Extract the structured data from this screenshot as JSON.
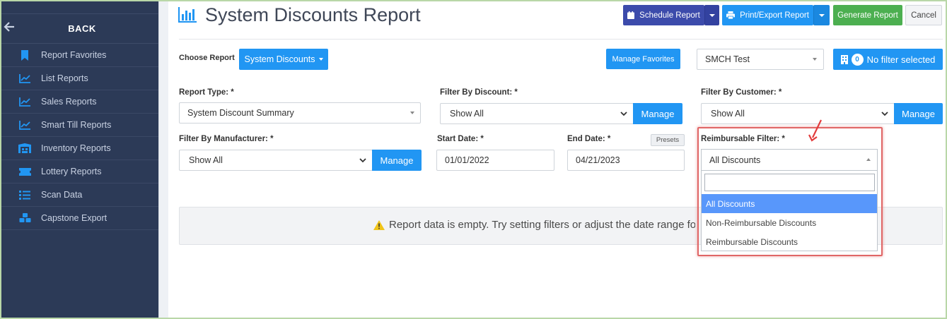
{
  "sidebar": {
    "back_label": "BACK",
    "items": [
      {
        "label": "Report Favorites",
        "icon": "bookmark-icon"
      },
      {
        "label": "List Reports",
        "icon": "line-chart-icon"
      },
      {
        "label": "Sales Reports",
        "icon": "line-chart-icon"
      },
      {
        "label": "Smart Till Reports",
        "icon": "line-chart-icon"
      },
      {
        "label": "Inventory Reports",
        "icon": "warehouse-icon"
      },
      {
        "label": "Lottery Reports",
        "icon": "ticket-icon"
      },
      {
        "label": "Scan Data",
        "icon": "list-icon"
      },
      {
        "label": "Capstone Export",
        "icon": "cubes-icon"
      }
    ]
  },
  "header": {
    "title": "System Discounts Report",
    "schedule_label": "Schedule Report",
    "print_label": "Print/Export Report",
    "generate_label": "Generate Report",
    "cancel_label": "Cancel"
  },
  "toolbar": {
    "choose_label": "Choose Report",
    "report_button": "System Discounts",
    "manage_favorites": "Manage Favorites",
    "store_value": "SMCH Test",
    "filter_count": "0",
    "filter_label": "No filter selected"
  },
  "filters": {
    "report_type": {
      "label": "Report Type: *",
      "value": "System Discount Summary"
    },
    "discount": {
      "label": "Filter By Discount: *",
      "value": "Show All",
      "manage": "Manage"
    },
    "customer": {
      "label": "Filter By Customer: *",
      "value": "Show All",
      "manage": "Manage"
    },
    "manufacturer": {
      "label": "Filter By Manufacturer: *",
      "value": "Show All",
      "manage": "Manage"
    },
    "start_date": {
      "label": "Start Date: *",
      "value": "01/01/2022"
    },
    "end_date": {
      "label": "End Date: *",
      "value": "04/21/2023",
      "presets": "Presets"
    },
    "reimbursable": {
      "label": "Reimbursable Filter: *",
      "value": "All Discounts",
      "search_value": "",
      "options": [
        "All Discounts",
        "Non-Reimbursable Discounts",
        "Reimbursable Discounts"
      ],
      "selected": "All Discounts"
    }
  },
  "empty_message": "Report data is empty. Try setting filters or adjust the date range fo",
  "colors": {
    "sidebar_bg": "#2c3a57",
    "primary": "#2196f3",
    "schedule": "#3c4bab",
    "generate": "#4caf50",
    "highlight": "#e06666",
    "selected_option": "#5897fb"
  }
}
